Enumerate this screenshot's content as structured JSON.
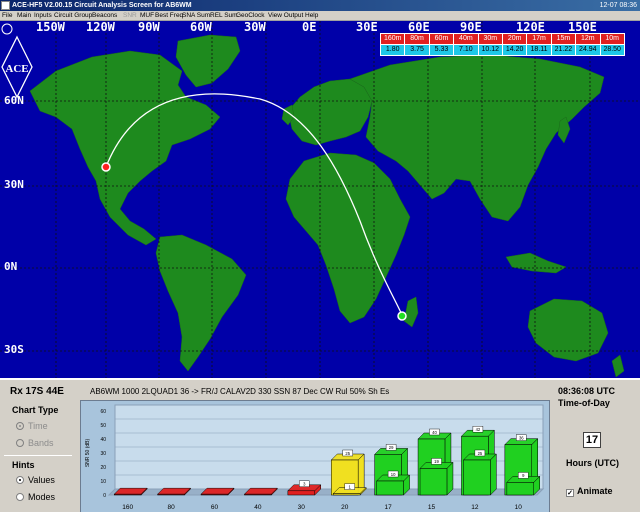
{
  "window": {
    "title": "ACE-HF5 V2.00.15 Circuit Analysis Screen for AB6WM",
    "clock": "12-07 08:36"
  },
  "menu": [
    {
      "label": "File",
      "enabled": true
    },
    {
      "label": "Main",
      "enabled": true
    },
    {
      "label": "Inputs",
      "enabled": true
    },
    {
      "label": "Circuit Group",
      "enabled": true
    },
    {
      "label": "Beacons",
      "enabled": true
    },
    {
      "label": "SNR",
      "enabled": false
    },
    {
      "label": "MUF",
      "enabled": true
    },
    {
      "label": "Best Freq",
      "enabled": true
    },
    {
      "label": "SNA Sum.",
      "enabled": true
    },
    {
      "label": "REL Sum.",
      "enabled": true
    },
    {
      "label": "GeoClock",
      "enabled": true
    },
    {
      "label": "View Output",
      "enabled": true
    },
    {
      "label": "Help",
      "enabled": true
    }
  ],
  "map": {
    "logo_text": "ACE",
    "lon_labels": [
      "150W",
      "120W",
      "90W",
      "60W",
      "30W",
      "0E",
      "30E",
      "60E",
      "90E",
      "120E",
      "150E"
    ],
    "lat_labels": [
      "60N",
      "30N",
      "0N",
      "30S"
    ],
    "ocean_color": "#0000a8",
    "land_color": "#1e8a1e",
    "tx_color": "#ff2020",
    "rx_color": "#20e020"
  },
  "muf_table": {
    "bands": [
      "160m",
      "80m",
      "60m",
      "40m",
      "30m",
      "20m",
      "17m",
      "15m",
      "12m",
      "10m"
    ],
    "mufs": [
      "1.80",
      "3.75",
      "5.33",
      "7.10",
      "10.12",
      "14.20",
      "18.11",
      "21.22",
      "24.94",
      "28.50"
    ]
  },
  "panel": {
    "rx": "Rx 17S 44E",
    "path_info": "AB6WM 1000 2LQUAD1 36 -> FR/J CALAV2D 330 SSN 87 Dec CW Rul 50% Sh Es",
    "time": "08:36:08 UTC",
    "time_of_day_label": "Time-of-Day",
    "hour_value": "17",
    "hours_label": "Hours (UTC)",
    "animate_label": "Animate",
    "animate_checked": true
  },
  "chart_type": {
    "title": "Chart Type",
    "options": [
      {
        "label": "Time",
        "selected": true,
        "enabled": false
      },
      {
        "label": "Bands",
        "selected": false,
        "enabled": false
      }
    ]
  },
  "hints": {
    "title": "Hints",
    "options": [
      {
        "label": "Values",
        "selected": true,
        "enabled": true
      },
      {
        "label": "Modes",
        "selected": false,
        "enabled": true
      }
    ]
  },
  "chart_data": {
    "type": "bar",
    "ylabel": "SNR 50 (dB)",
    "ylim": [
      0,
      60
    ],
    "yticks": [
      0,
      10,
      20,
      30,
      40,
      50,
      60
    ],
    "categories": [
      "160",
      "80",
      "60",
      "40",
      "30",
      "20",
      "17",
      "15",
      "12",
      "10"
    ],
    "series": [
      {
        "values": [
          0,
          0,
          0,
          0,
          3,
          25,
          29,
          40,
          42,
          36
        ]
      },
      {
        "values": [
          0,
          0,
          0,
          0,
          0,
          1,
          10,
          19,
          25,
          9
        ]
      }
    ],
    "bar_colors": [
      "#e02020",
      "#e02020",
      "#e02020",
      "#e02020",
      "#e02020",
      "#f0e020",
      "#20d020",
      "#20d020",
      "#20d020",
      "#20d020"
    ],
    "data_labels": {
      "front": [
        "",
        "",
        "",
        "",
        "3",
        "25",
        "29",
        "40",
        "42",
        "36"
      ],
      "back": [
        "",
        "",
        "",
        "",
        "",
        "1",
        "10",
        "19",
        "25",
        "9"
      ]
    }
  }
}
